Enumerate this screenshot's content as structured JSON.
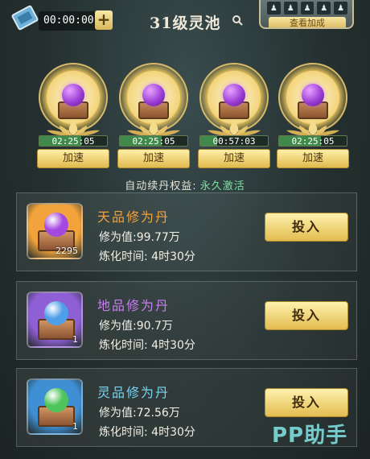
{
  "topbar": {
    "timer": "00:00:00",
    "plus": "+",
    "title": "31级灵池",
    "view_label": "查看加成"
  },
  "slots": [
    {
      "time": "02:25:05",
      "progress": 0.62,
      "button": "加速"
    },
    {
      "time": "02:25:05",
      "progress": 0.62,
      "button": "加速"
    },
    {
      "time": "00:57:03",
      "progress": 0.25,
      "button": "加速"
    },
    {
      "time": "02:25:05",
      "progress": 0.62,
      "button": "加速"
    }
  ],
  "auto": {
    "label": "自动续丹权益:",
    "value": "永久激活"
  },
  "pills": [
    {
      "name": "天品修为丹",
      "value": "修为值:99.77万",
      "time": "炼化时间: 4时30分",
      "count": "2295",
      "button": "投入",
      "name_color": "#f0a33a",
      "thumb_bg": "#f2a33b",
      "orb_color": "#a548e0"
    },
    {
      "name": "地品修为丹",
      "value": "修为值:90.7万",
      "time": "炼化时间: 4时30分",
      "count": "1",
      "button": "投入",
      "name_color": "#c97ef0",
      "thumb_bg": "#8f5fd6",
      "orb_color": "#4e9ee8"
    },
    {
      "name": "灵品修为丹",
      "value": "修为值:72.56万",
      "time": "炼化时间: 4时30分",
      "count": "1",
      "button": "投入",
      "name_color": "#78d4f0",
      "thumb_bg": "#3f8fd4",
      "orb_color": "#4fc45a"
    }
  ],
  "watermark": "PP助手"
}
